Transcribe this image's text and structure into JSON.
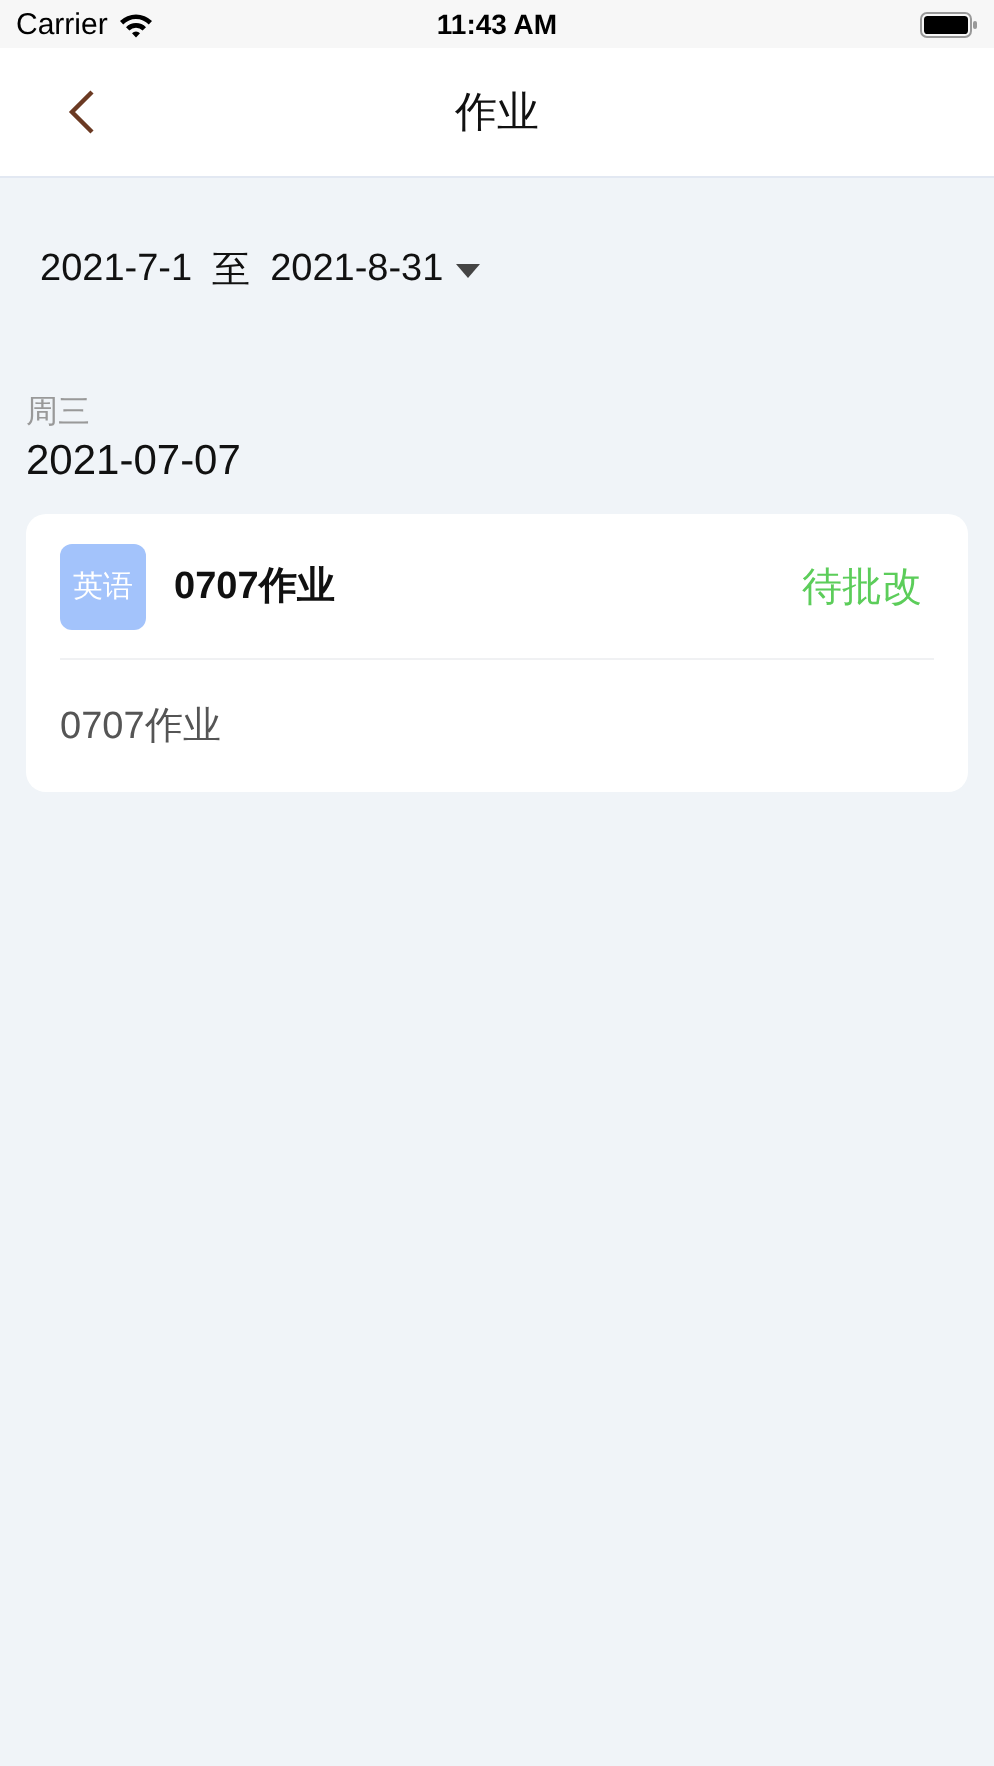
{
  "status_bar": {
    "carrier": "Carrier",
    "time": "11:43 AM"
  },
  "nav": {
    "title": "作业"
  },
  "date_range": {
    "start": "2021-7-1",
    "separator": "至",
    "end": "2021-8-31"
  },
  "days": [
    {
      "weekday": "周三",
      "date": "2021-07-07",
      "items": [
        {
          "subject": "英语",
          "title": "0707作业",
          "status": "待批改",
          "content": "0707作业"
        }
      ]
    }
  ]
}
